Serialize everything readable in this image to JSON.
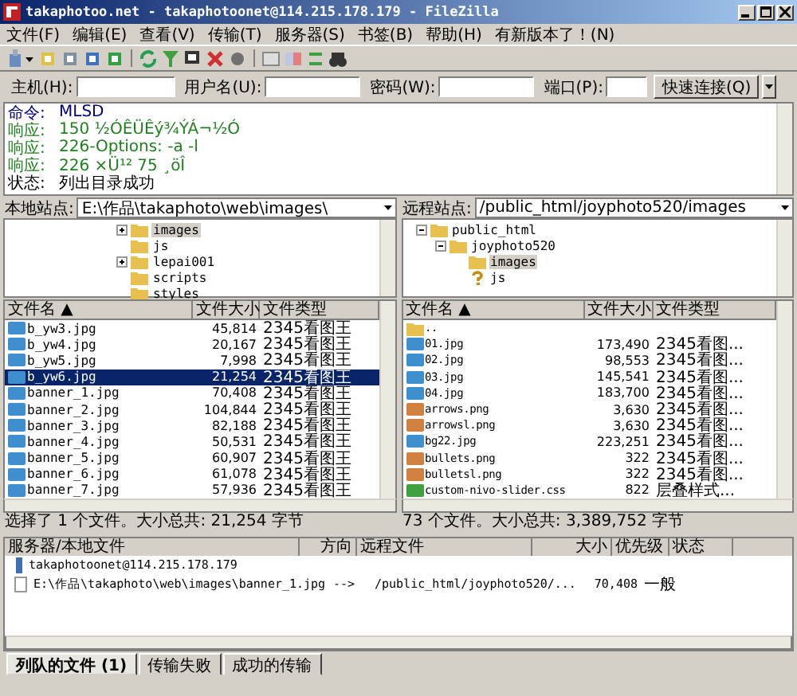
{
  "window": {
    "title": "takaphotoo.net - takaphotoonet@114.215.178.179 - FileZilla"
  },
  "menu": [
    "文件(F)",
    "编辑(E)",
    "查看(V)",
    "传输(T)",
    "服务器(S)",
    "书签(B)",
    "帮助(H)",
    "有新版本了！(N)"
  ],
  "quickconnect": {
    "host_label": "主机(H):",
    "user_label": "用户名(U):",
    "password_label": "密码(W):",
    "port_label": "端口(P):",
    "button": "快速连接(Q)"
  },
  "log": [
    {
      "kind": "command",
      "label": "命令:",
      "text": "MLSD"
    },
    {
      "kind": "response",
      "label": "响应:",
      "text": "150 ½ÓÊÜÊý¾ÝÁ¬½Ó"
    },
    {
      "kind": "response",
      "label": "响应:",
      "text": "226-Options: -a -l"
    },
    {
      "kind": "response",
      "label": "响应:",
      "text": "226 ×Ü¹² 75 ¸öÎ"
    },
    {
      "kind": "status",
      "label": "状态:",
      "text": "列出目录成功"
    }
  ],
  "panes": [
    {
      "site_label": "本地站点:",
      "path": "E:\\作品\\takaphoto\\web\\images\\",
      "tree": [
        {
          "name": "images",
          "kind": "folder",
          "expandable": true,
          "selected": true
        },
        {
          "name": "js",
          "kind": "folder",
          "expandable": false,
          "selected": false
        },
        {
          "name": "lepai001",
          "kind": "folder",
          "expandable": true,
          "selected": false
        },
        {
          "name": "scripts",
          "kind": "folder",
          "expandable": false,
          "selected": false
        },
        {
          "name": "styles",
          "kind": "folder",
          "expandable": false,
          "selected": false
        }
      ],
      "columns": [
        "文件名 ▲",
        "文件大小",
        "文件类型"
      ],
      "files": [
        {
          "name": "b_yw3.jpg",
          "size": "45,814",
          "type": "2345看图王",
          "kind": "image",
          "selected": false
        },
        {
          "name": "b_yw4.jpg",
          "size": "20,167",
          "type": "2345看图王",
          "kind": "image",
          "selected": false
        },
        {
          "name": "b_yw5.jpg",
          "size": "7,998",
          "type": "2345看图王",
          "kind": "image",
          "selected": false
        },
        {
          "name": "b_yw6.jpg",
          "size": "21,254",
          "type": "2345看图王",
          "kind": "image",
          "selected": true
        },
        {
          "name": "banner_1.jpg",
          "size": "70,408",
          "type": "2345看图王",
          "kind": "image",
          "selected": false
        },
        {
          "name": "banner_2.jpg",
          "size": "104,844",
          "type": "2345看图王",
          "kind": "image",
          "selected": false
        },
        {
          "name": "banner_3.jpg",
          "size": "82,188",
          "type": "2345看图王",
          "kind": "image",
          "selected": false
        },
        {
          "name": "banner_4.jpg",
          "size": "50,531",
          "type": "2345看图王",
          "kind": "image",
          "selected": false
        },
        {
          "name": "banner_5.jpg",
          "size": "60,907",
          "type": "2345看图王",
          "kind": "image",
          "selected": false
        },
        {
          "name": "banner_6.jpg",
          "size": "61,078",
          "type": "2345看图王",
          "kind": "image",
          "selected": false
        },
        {
          "name": "banner_7.jpg",
          "size": "57,936",
          "type": "2345看图王",
          "kind": "image",
          "selected": false
        }
      ],
      "status": "选择了 1 个文件。大小总共: 21,254 字节"
    },
    {
      "site_label": "远程站点:",
      "path": "/public_html/joyphoto520/images",
      "tree": [
        {
          "name": "public_html",
          "kind": "folder",
          "expandable": true,
          "selected": false,
          "children": [
            {
              "name": "joyphoto520",
              "kind": "folder",
              "expandable": true,
              "selected": false,
              "children": [
                {
                  "name": "images",
                  "kind": "folder",
                  "expandable": false,
                  "selected": true
                },
                {
                  "name": "js",
                  "kind": "unknown",
                  "expandable": false,
                  "selected": false
                }
              ]
            }
          ]
        }
      ],
      "columns": [
        "文件名 ▲",
        "文件大小",
        "文件类型"
      ],
      "files": [
        {
          "name": "..",
          "kind": "folder",
          "selected": false
        },
        {
          "name": "01.jpg",
          "size": "173,490",
          "type": "2345看图...",
          "kind": "image",
          "selected": false
        },
        {
          "name": "02.jpg",
          "size": "98,553",
          "type": "2345看图...",
          "kind": "image",
          "selected": false
        },
        {
          "name": "03.jpg",
          "size": "145,541",
          "type": "2345看图...",
          "kind": "image",
          "selected": false
        },
        {
          "name": "04.jpg",
          "size": "183,700",
          "type": "2345看图...",
          "kind": "image",
          "selected": false
        },
        {
          "name": "arrows.png",
          "size": "3,630",
          "type": "2345看图...",
          "kind": "png",
          "selected": false
        },
        {
          "name": "arrowsl.png",
          "size": "3,630",
          "type": "2345看图...",
          "kind": "png",
          "selected": false
        },
        {
          "name": "bg22.jpg",
          "size": "223,251",
          "type": "2345看图...",
          "kind": "image",
          "selected": false
        },
        {
          "name": "bullets.png",
          "size": "322",
          "type": "2345看图...",
          "kind": "png",
          "selected": false
        },
        {
          "name": "bulletsl.png",
          "size": "322",
          "type": "2345看图...",
          "kind": "png",
          "selected": false
        },
        {
          "name": "custom-nivo-slider.css",
          "size": "822",
          "type": "层叠样式...",
          "kind": "css",
          "selected": false
        }
      ],
      "status": "73 个文件。大小总共: 3,389,752 字节"
    }
  ],
  "queue": {
    "columns": [
      "服务器/本地文件",
      "方向",
      "远程文件",
      "大小",
      "优先级",
      "状态"
    ],
    "server": "takaphotoonet@114.215.178.179",
    "items": [
      {
        "local": "E:\\作品\\takaphoto\\web\\images\\banner_1.jpg",
        "direction": "-->",
        "remote": "/public_html/joyphoto520/...",
        "size": "70,408",
        "priority": "一般"
      }
    ]
  },
  "tabs": [
    {
      "label": "列队的文件 (1)",
      "selected": true
    },
    {
      "label": "传输失败",
      "selected": false
    },
    {
      "label": "成功的传输",
      "selected": false
    }
  ]
}
